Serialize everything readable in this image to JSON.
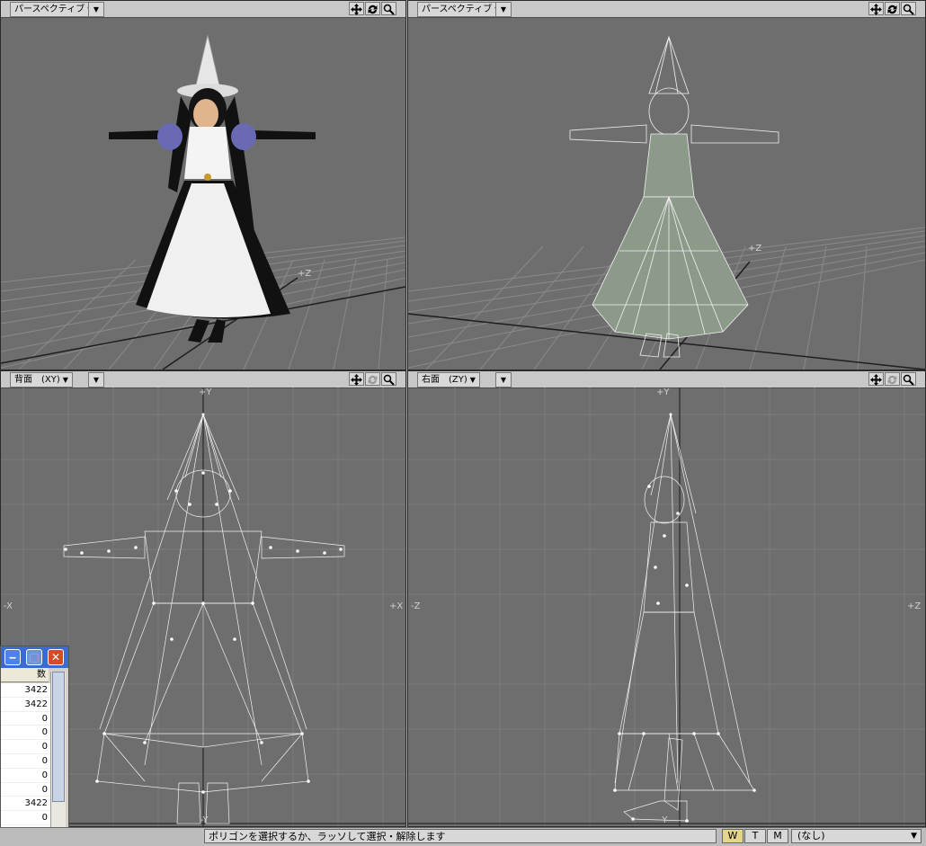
{
  "viewports": {
    "top_left": {
      "view_label": "パースペクティブ",
      "z_label": "+Z"
    },
    "top_right": {
      "view_label": "パースペクティブ",
      "z_label": "+Z"
    },
    "bottom_left": {
      "view_label": "背面　(XY)",
      "y_top": "+Y",
      "y_bottom": "-Y",
      "x_left": "-X",
      "x_right": "+X"
    },
    "bottom_right": {
      "view_label": "右面　(ZY)",
      "y_top": "+Y",
      "y_bottom": "-Y",
      "z_left": "-Z",
      "z_right": "+Z"
    }
  },
  "tool_icons": [
    "move-icon",
    "rotate-icon",
    "zoom-icon"
  ],
  "stats_window": {
    "column_header": "数",
    "values": [
      "3422",
      "3422",
      "0",
      "0",
      "0",
      "0",
      "0",
      "0",
      "3422",
      "0"
    ]
  },
  "statusbar": {
    "message": "ポリゴンを選択するか、ラッソして選択・解除します",
    "modes": [
      "W",
      "T",
      "M"
    ],
    "active_mode": "W",
    "selection_value": "(なし)"
  },
  "colors": {
    "viewport_bg": "#6e6e6e",
    "wire": "#f2f2f2",
    "active_mode": "#e3d68a",
    "title_bar": "#3b6ad6"
  }
}
